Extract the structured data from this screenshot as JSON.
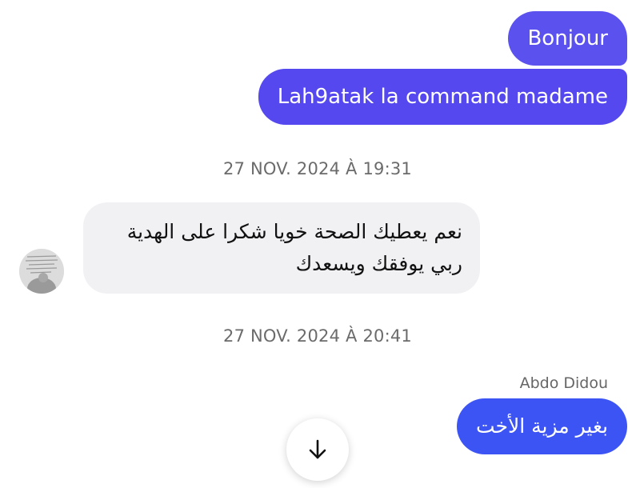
{
  "messages": {
    "outgoing": [
      {
        "text": "Bonjour"
      },
      {
        "text": "Lah9atak la command madame"
      }
    ],
    "incoming_text": "نعم يعطيك الصحة خويا شكرا على الهدية ربي يوفقك ويسعدك",
    "last_outgoing": {
      "sender": "Abdo Didou",
      "text": "بغير مزية الأخت"
    }
  },
  "timestamps": {
    "first": "27 NOV. 2024 À 19:31",
    "second": "27 NOV. 2024 À 20:41"
  },
  "icons": {
    "scroll_down": "arrow-down-icon",
    "avatar": "contact-avatar"
  },
  "colors": {
    "outgoing_bubble": "#5b51ee",
    "outgoing_bubble_alt": "#3d54f5",
    "incoming_bubble": "#f1f1f4",
    "timestamp_text": "#6b6b6b"
  }
}
